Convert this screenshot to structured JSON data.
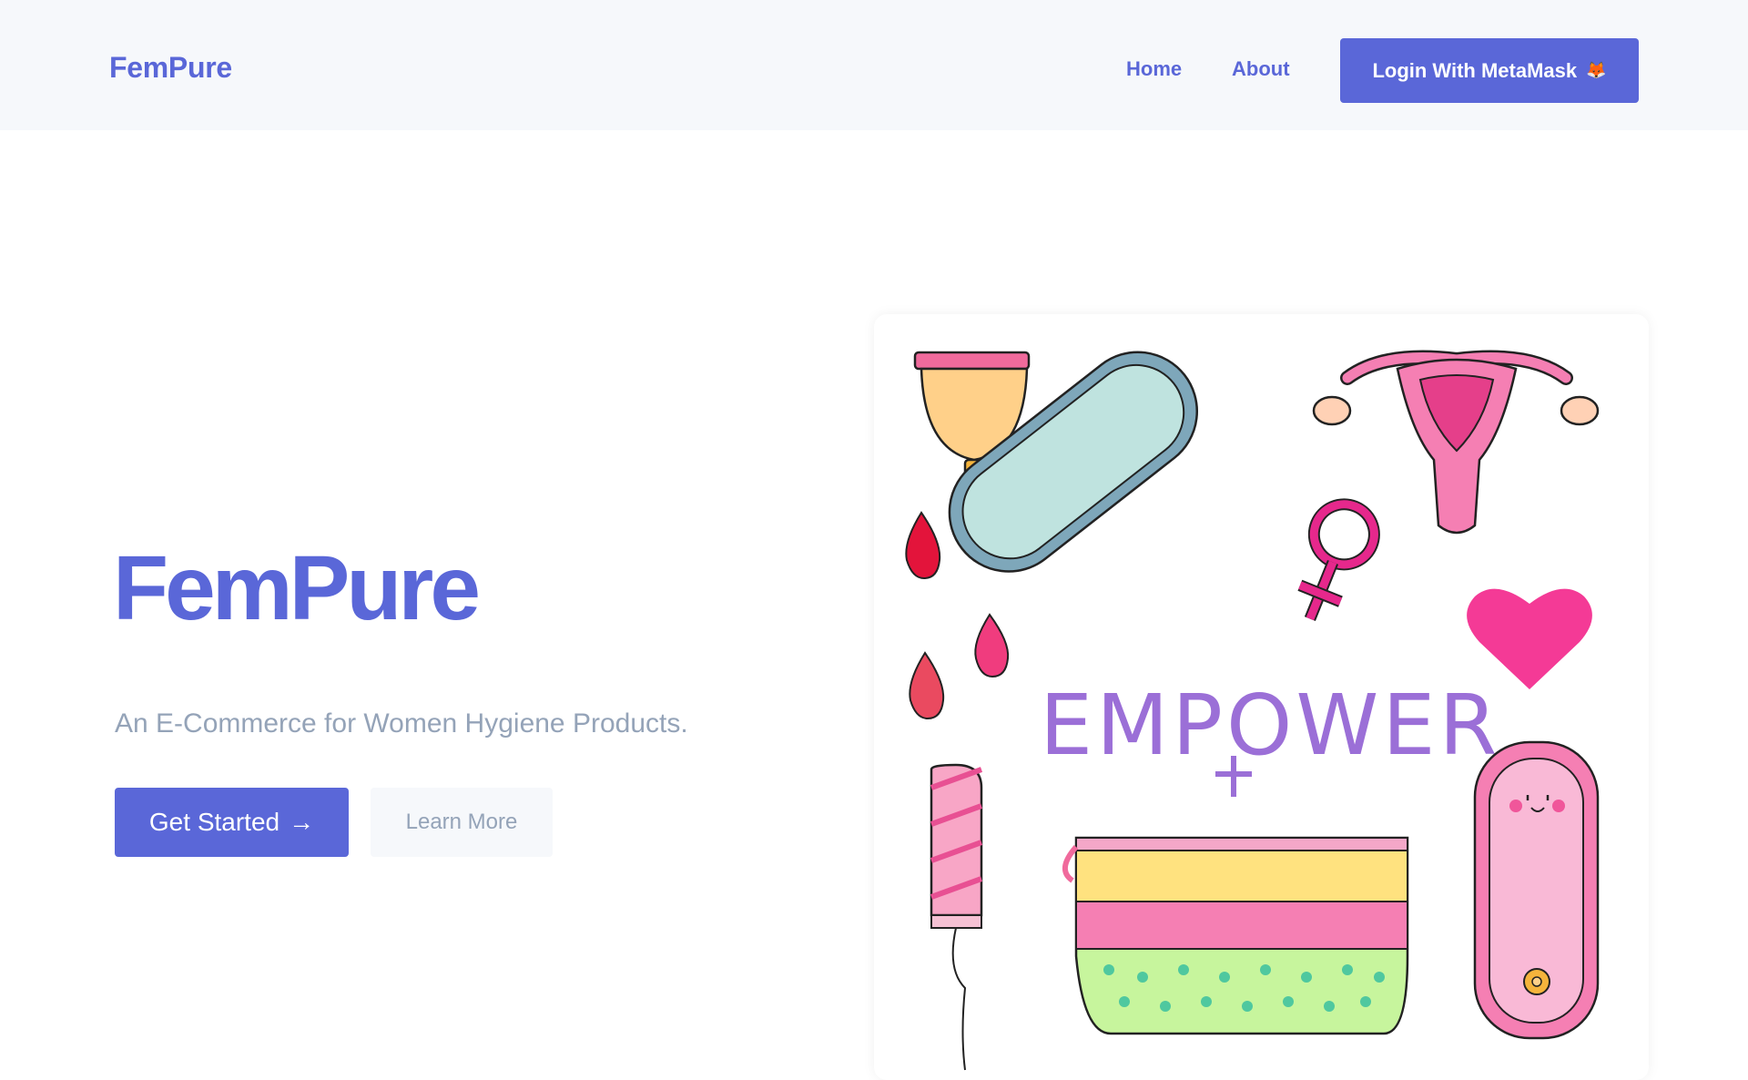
{
  "brand": "FemPure",
  "nav": {
    "home": "Home",
    "about": "About",
    "login_label": "Login With MetaMask",
    "login_icon": "🦊"
  },
  "hero": {
    "title": "FemPure",
    "subtitle": "An E-Commerce for Women Hygiene Products.",
    "primary_label": "Get Started",
    "primary_icon": "→",
    "secondary_label": "Learn More",
    "illustration_word": "EMPOWER"
  },
  "colors": {
    "accent": "#5a67d8",
    "muted": "#94a3b8",
    "nav_bg": "#f6f8fb"
  }
}
